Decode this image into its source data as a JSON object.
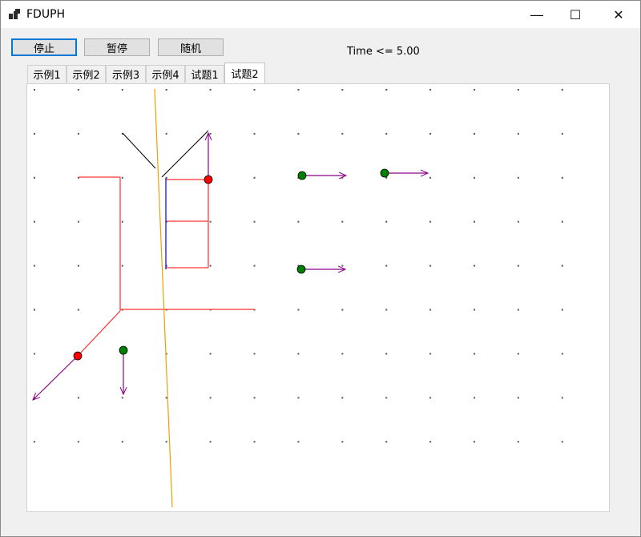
{
  "window": {
    "title": "FDUPH"
  },
  "toolbar": {
    "stop_label": "停止",
    "pause_label": "暂停",
    "random_label": "随机"
  },
  "status": {
    "time_text": "Time <= 5.00"
  },
  "tabs": [
    {
      "label": "示例1"
    },
    {
      "label": "示例2"
    },
    {
      "label": "示例3"
    },
    {
      "label": "示例4"
    },
    {
      "label": "试题1"
    },
    {
      "label": "试题2"
    }
  ],
  "selected_tab": "试题2",
  "colors": {
    "red_line": "#ff3030",
    "blue_line": "#0000cc",
    "orange_line": "#f0a000",
    "black_line": "#000000",
    "vector": "#8b008b",
    "red_ball": "#ff0000",
    "green_ball": "#008000",
    "grid_dot": "#555555"
  }
}
